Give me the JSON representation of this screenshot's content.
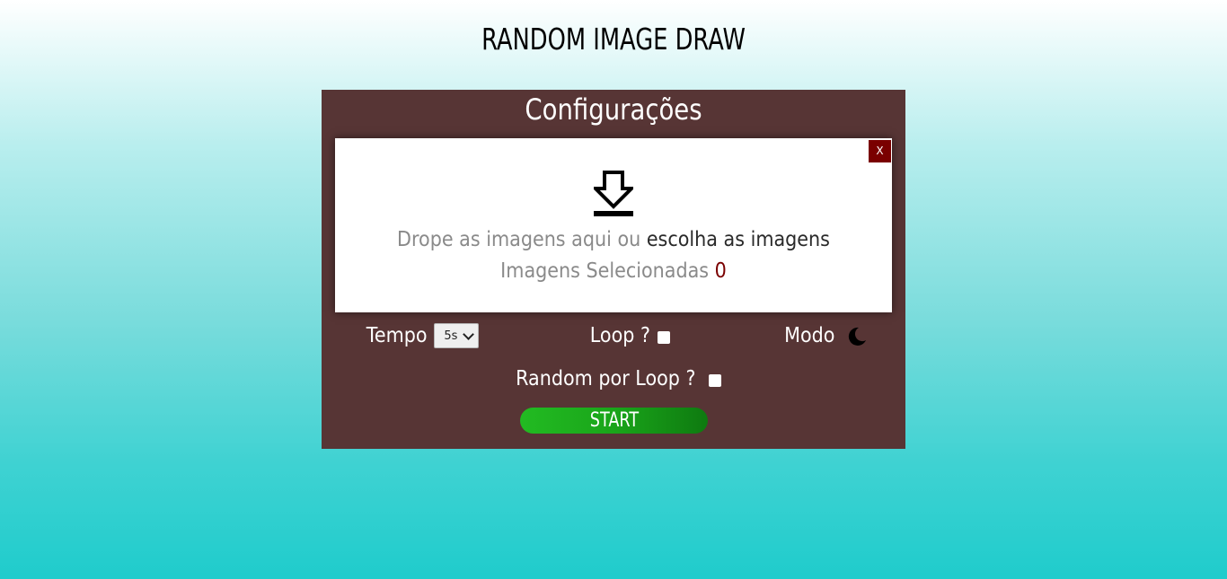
{
  "app": {
    "title": "RANDOM IMAGE DRAW"
  },
  "panel": {
    "title": "Configurações",
    "close_label": "X",
    "dropzone": {
      "icon": "download-icon",
      "drop_prefix": "Drope as imagens aqui ou ",
      "choose_link": "escolha as imagens",
      "selected_label": "Imagens Selecionadas ",
      "selected_count": "0"
    },
    "tempo": {
      "label": "Tempo",
      "selected_value": "5s"
    },
    "loop": {
      "label": "Loop ?",
      "checked": false
    },
    "modo": {
      "label": "Modo",
      "icon": "moon-icon"
    },
    "random_loop": {
      "label": "Random por Loop ?",
      "checked": false
    },
    "start_label": "START"
  },
  "colors": {
    "panel_bg": "#573535",
    "close_bg": "#7a0000",
    "count_color": "#7a0000",
    "start_green": "#1aa51a"
  }
}
